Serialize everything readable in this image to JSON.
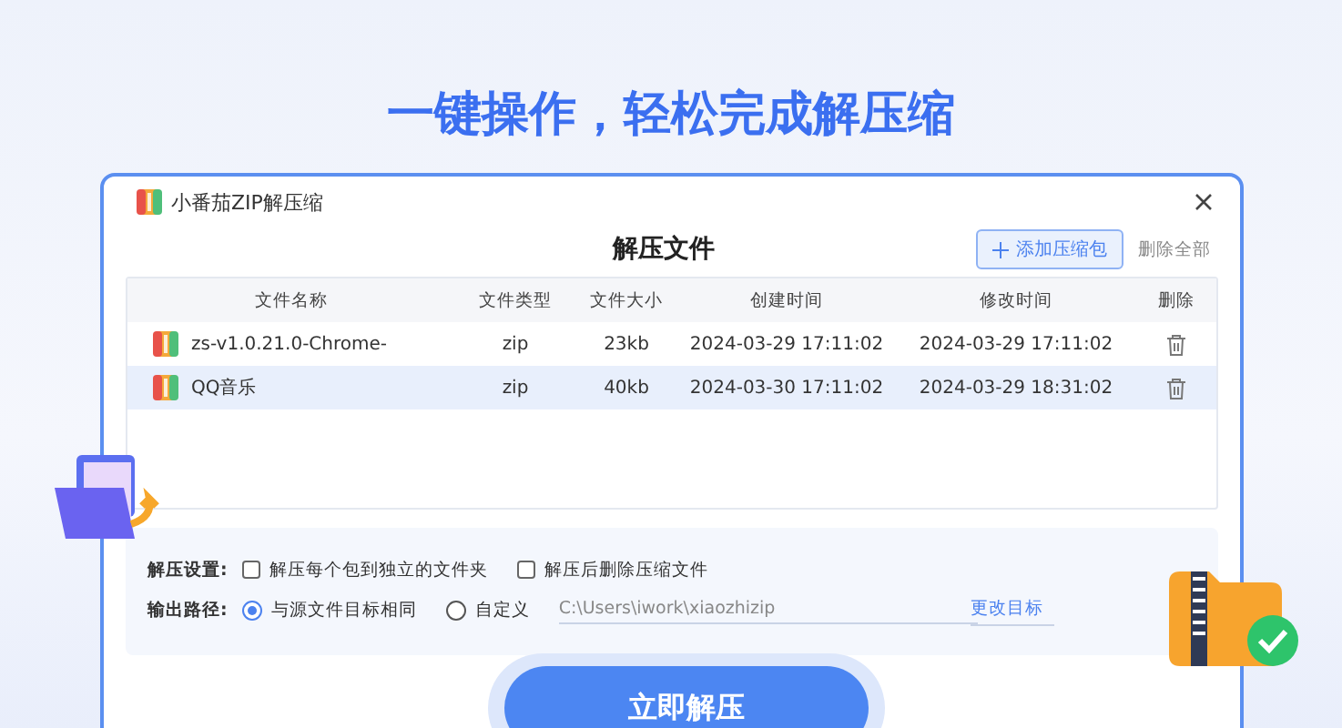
{
  "headline": "一键操作，轻松完成解压缩",
  "window": {
    "title": "小番茄ZIP解压缩",
    "heading": "解压文件",
    "add_button": "添加压缩包",
    "delete_all": "删除全部"
  },
  "table": {
    "columns": [
      "文件名称",
      "文件类型",
      "文件大小",
      "创建时间",
      "修改时间",
      "删除"
    ],
    "rows": [
      {
        "name": "zs-v1.0.21.0-Chrome-",
        "type": "zip",
        "size": "23kb",
        "created": "2024-03-29  17:11:02",
        "modified": "2024-03-29  17:11:02",
        "selected": false
      },
      {
        "name": "QQ音乐",
        "type": "zip",
        "size": "40kb",
        "created": "2024-03-30  17:11:02",
        "modified": "2024-03-29  18:31:02",
        "selected": true
      }
    ]
  },
  "settings": {
    "label": "解压设置:",
    "options": [
      {
        "label": "解压每个包到独立的文件夹",
        "checked": false
      },
      {
        "label": "解压后删除压缩文件",
        "checked": false
      }
    ]
  },
  "output": {
    "label": "输出路径:",
    "choices": [
      {
        "label": "与源文件目标相同",
        "selected": true
      },
      {
        "label": "自定义",
        "selected": false
      }
    ],
    "path": "C:\\Users\\iwork\\xiaozhizip",
    "change_link": "更改目标"
  },
  "extract_button": "立即解压"
}
